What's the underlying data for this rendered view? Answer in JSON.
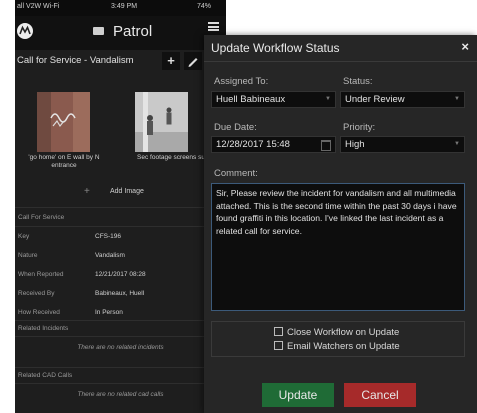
{
  "phone": {
    "status": {
      "carrier": "all V2W Wi-Fi",
      "time": "3:49 PM",
      "battery": "74%"
    },
    "header": {
      "logo_icon": "motorola-logo",
      "nav_icon": "mail-icon",
      "title": "Patrol",
      "menu_icon": "hamburger-icon"
    },
    "subbar": {
      "title": "Call for Service - Vandalism",
      "add_label": "+",
      "edit_icon": "pencil-icon"
    },
    "media": [
      {
        "caption": "'go home' on E wall by N entrance"
      },
      {
        "caption": "Sec footage screens subjects"
      }
    ],
    "add_image": {
      "icon": "+",
      "label": "Add Image"
    },
    "call_section": {
      "heading": "Call For Service",
      "rows": [
        {
          "key": "Key",
          "value": "CFS-196"
        },
        {
          "key": "Nature",
          "value": "Vandalism"
        },
        {
          "key": "When Reported",
          "value": "12/21/2017 08:28"
        },
        {
          "key": "Received By",
          "value": "Babineaux, Huell"
        },
        {
          "key": "How Received",
          "value": "In Person"
        }
      ]
    },
    "related_incidents": {
      "heading": "Related Incidents",
      "empty": "There are no related incidents"
    },
    "related_cad": {
      "heading": "Related CAD Calls",
      "empty": "There are no related cad calls"
    }
  },
  "modal": {
    "title": "Update Workflow Status",
    "close": "×",
    "assigned_to": {
      "label": "Assigned To:",
      "value": "Huell Babineaux"
    },
    "status": {
      "label": "Status:",
      "value": "Under Review"
    },
    "due_date": {
      "label": "Due Date:",
      "value": "12/28/2017 15:48"
    },
    "priority": {
      "label": "Priority:",
      "value": "High"
    },
    "comment": {
      "label": "Comment:",
      "value": "Sir, Please review the incident for vandalism and all multimedia attached. This is the second time within the past 30 days i have found graffiti in this location. I've linked the last incident as a related call for service."
    },
    "options": [
      {
        "label": "Close Workflow on Update",
        "checked": false
      },
      {
        "label": "Email Watchers on Update",
        "checked": false
      }
    ],
    "buttons": {
      "update": "Update",
      "cancel": "Cancel"
    },
    "colors": {
      "update": "#1f6b36",
      "cancel": "#a62a2a",
      "background": "#262626"
    }
  }
}
